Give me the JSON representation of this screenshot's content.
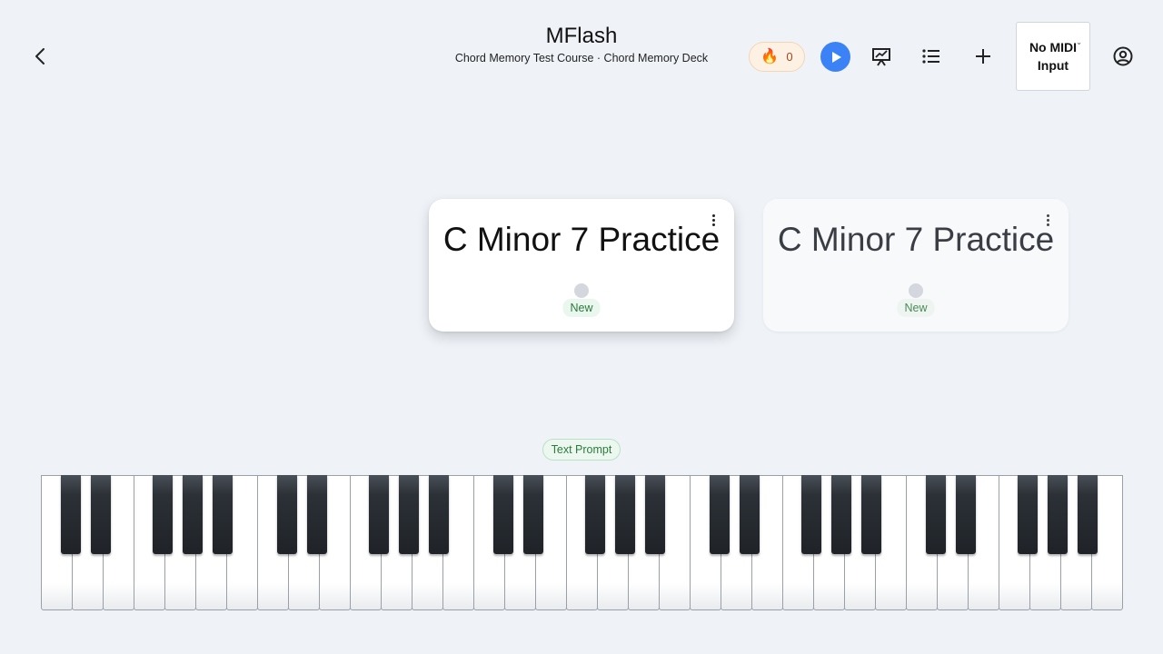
{
  "header": {
    "app_title": "MFlash",
    "breadcrumb": "Chord Memory Test Course · Chord Memory Deck",
    "streak_count": "0",
    "midi_select": {
      "value": "No MIDI Input"
    }
  },
  "cards": [
    {
      "title": "C Minor 7 Practice",
      "status": "New"
    },
    {
      "title": "C Minor 7 Practice",
      "status": "New"
    }
  ],
  "prompt_tag": "Text Prompt",
  "piano": {
    "white_keys": 35,
    "black_keys": 25
  },
  "colors": {
    "background": "#eff3f8",
    "play_button": "#3b82f6",
    "new_badge": "#2a7a3a"
  },
  "icons": [
    "back-arrow-icon",
    "flame-icon",
    "play-icon",
    "chart-presentation-icon",
    "list-icon",
    "plus-icon",
    "account-circle-icon"
  ]
}
